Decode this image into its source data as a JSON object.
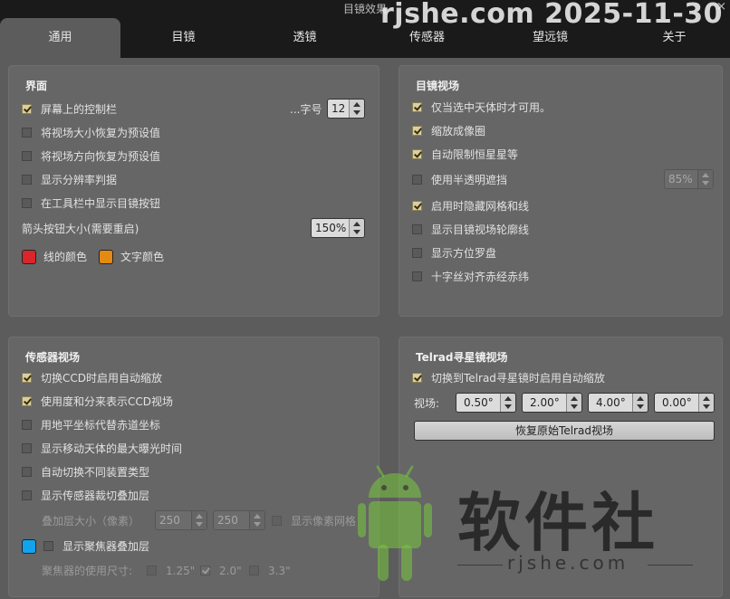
{
  "window": {
    "title": "目镜效果",
    "watermark": "rjshe.com 2025-11-30"
  },
  "tabs": [
    {
      "label": "通用",
      "active": true
    },
    {
      "label": "目镜",
      "active": false
    },
    {
      "label": "透镜",
      "active": false
    },
    {
      "label": "传感器",
      "active": false
    },
    {
      "label": "望远镜",
      "active": false
    },
    {
      "label": "关于",
      "active": false
    }
  ],
  "interface": {
    "title": "界面",
    "onscreen_control": {
      "label": "屏幕上的控制栏",
      "checked": true
    },
    "font_size_label": "...字号",
    "font_size_value": "12",
    "reset_size": {
      "label": "将视场大小恢复为预设值",
      "checked": false
    },
    "reset_orientation": {
      "label": "将视场方向恢复为预设值",
      "checked": false
    },
    "show_resolution": {
      "label": "显示分辨率判据",
      "checked": false
    },
    "toolbar_button": {
      "label": "在工具栏中显示目镜按钮",
      "checked": false
    },
    "arrow_size_label": "箭头按钮大小(需要重启)",
    "arrow_size_value": "150%",
    "line_color": {
      "label": "线的颜色",
      "color": "#d8262b"
    },
    "text_color": {
      "label": "文字颜色",
      "color": "#e48a12"
    }
  },
  "eyepiece_fov": {
    "title": "目镜视场",
    "only_selected": {
      "label": "仅当选中天体时才可用。",
      "checked": true
    },
    "scale_circle": {
      "label": "缩放成像圈",
      "checked": true
    },
    "limit_magnitude": {
      "label": "自动限制恒星星等",
      "checked": true
    },
    "semi_transparent": {
      "label": "使用半透明遮挡",
      "checked": false
    },
    "transparency_value": "85%",
    "hide_grid": {
      "label": "启用时隐藏网格和线",
      "checked": true
    },
    "show_outline": {
      "label": "显示目镜视场轮廓线",
      "checked": false
    },
    "show_compass": {
      "label": "显示方位罗盘",
      "checked": false
    },
    "crosshair_align": {
      "label": "十字丝对齐赤经赤纬",
      "checked": false
    }
  },
  "sensor_fov": {
    "title": "传感器视场",
    "auto_zoom": {
      "label": "切换CCD时启用自动缩放",
      "checked": true
    },
    "degrees_minutes": {
      "label": "使用度和分来表示CCD视场",
      "checked": true
    },
    "horizontal_coords": {
      "label": "用地平坐标代替赤道坐标",
      "checked": false
    },
    "max_exposure": {
      "label": "显示移动天体的最大曝光时间",
      "checked": false
    },
    "auto_switch": {
      "label": "自动切换不同装置类型",
      "checked": false
    },
    "crop_overlay": {
      "label": "显示传感器裁切叠加层",
      "checked": false
    },
    "overlay_size_label": "叠加层大小（像素）",
    "overlay_w": "250",
    "overlay_h": "250",
    "pixel_grid": {
      "label": "显示像素网格",
      "checked": false
    },
    "focuser_color": "#12a3ee",
    "focuser_overlay": {
      "label": "显示聚焦器叠加层",
      "checked": false
    },
    "focuser_size_label": "聚焦器的使用尺寸:",
    "focuser_sizes": [
      {
        "label": "1.25\"",
        "checked": false
      },
      {
        "label": "2.0\"",
        "checked": true
      },
      {
        "label": "3.3\"",
        "checked": false
      }
    ]
  },
  "telrad": {
    "title": "Telrad寻星镜视场",
    "auto_zoom": {
      "label": "切换到Telrad寻星镜时启用自动缩放",
      "checked": true
    },
    "fov_label": "视场:",
    "fov_values": [
      "0.50°",
      "2.00°",
      "4.00°",
      "0.00°"
    ],
    "reset_button": "恢复原始Telrad视场"
  },
  "overlay_watermark": {
    "big": "软件社",
    "small": "rjshe.com"
  }
}
